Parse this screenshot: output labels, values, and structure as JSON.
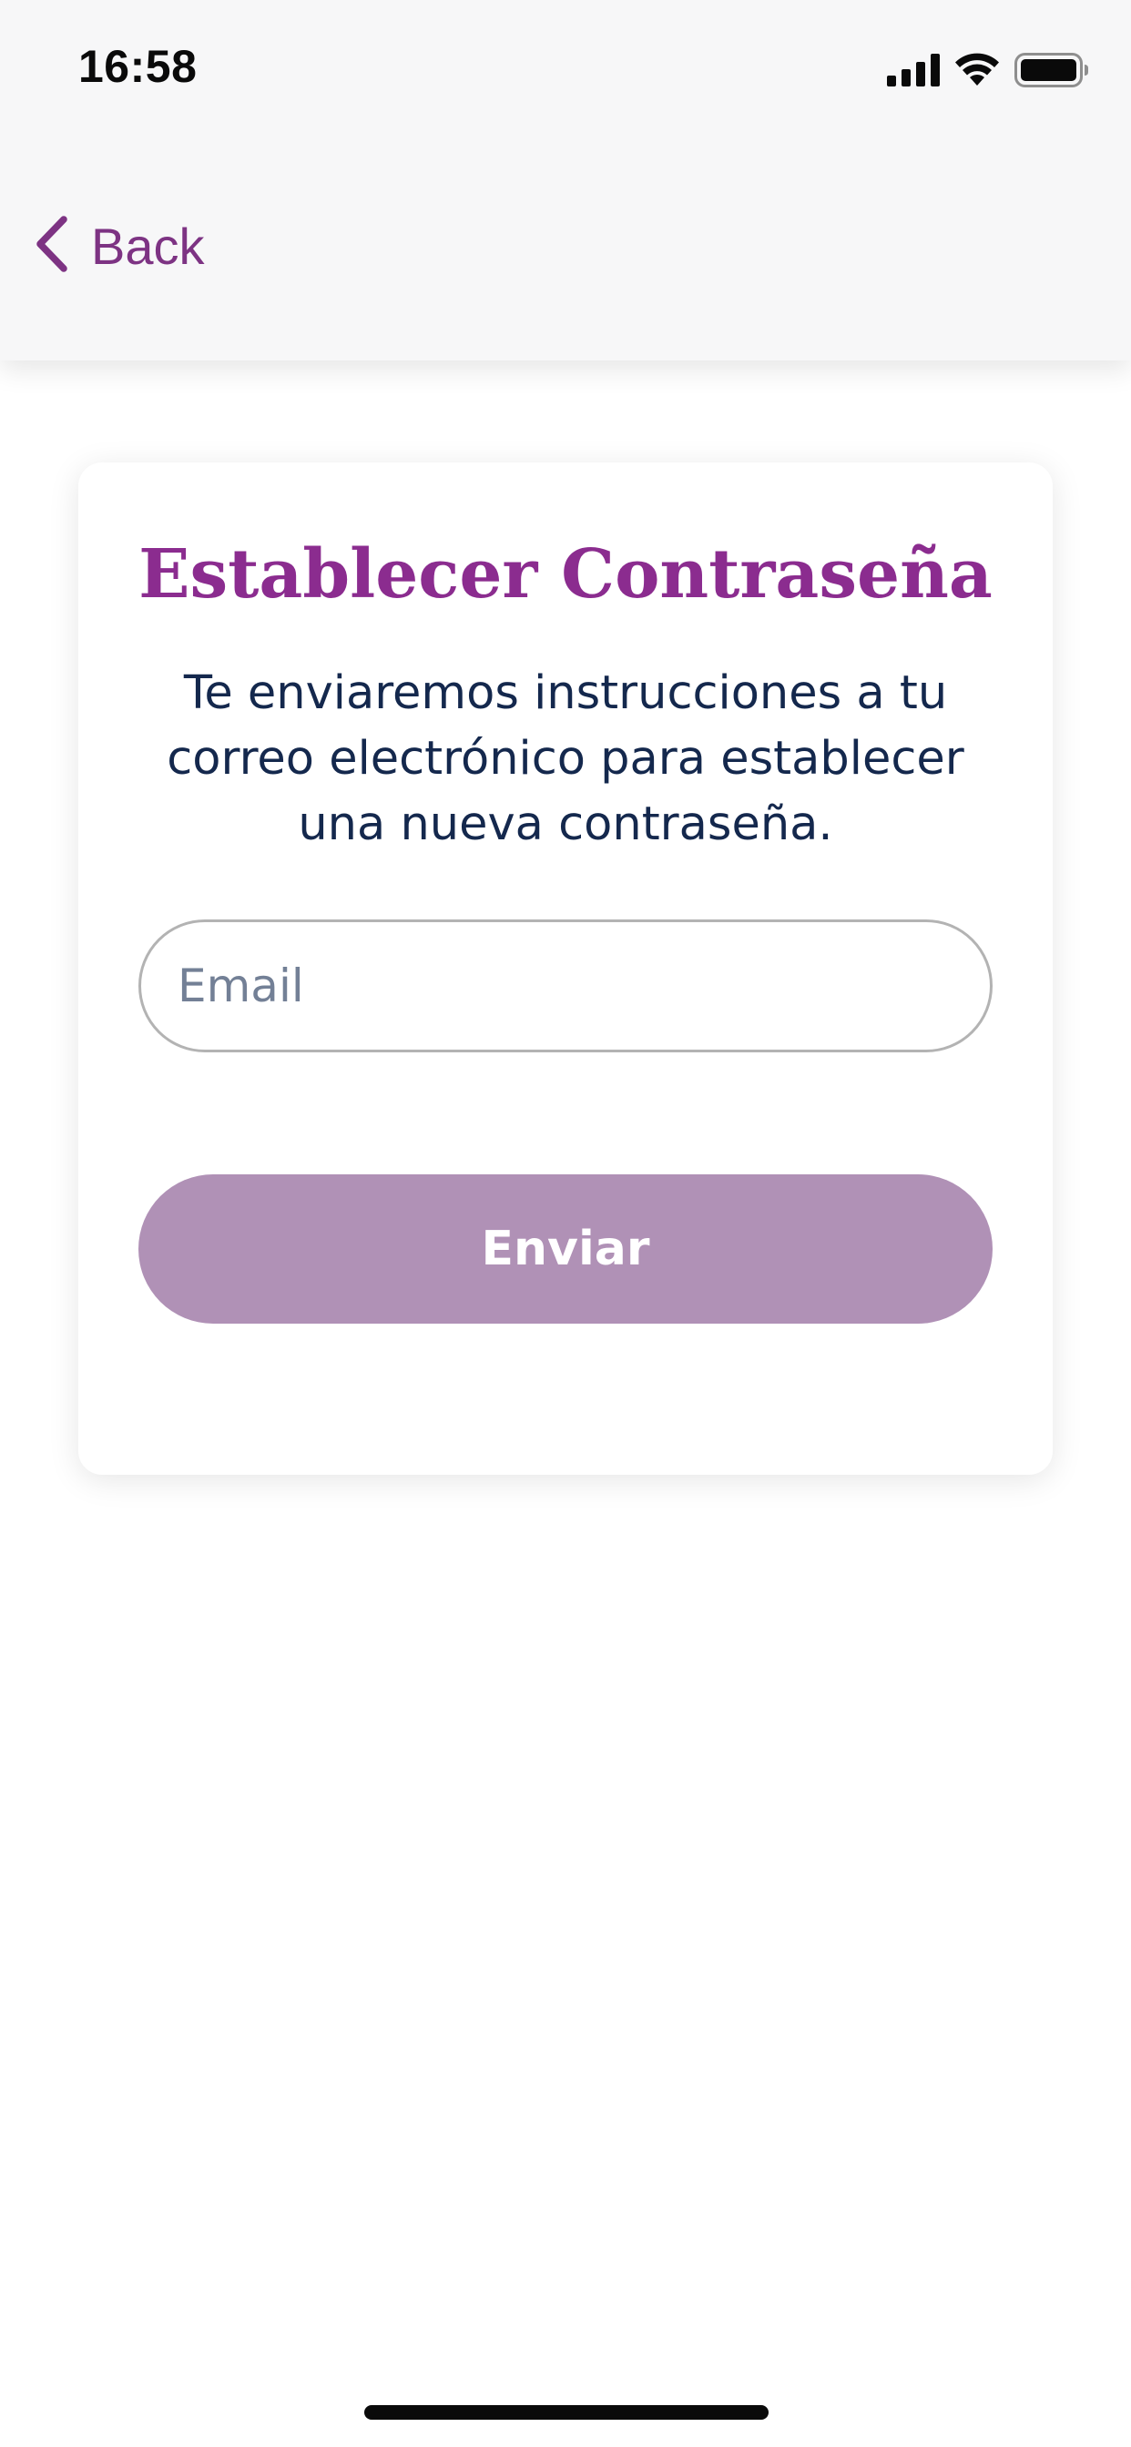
{
  "status_bar": {
    "time": "16:58",
    "icons": [
      "cellular-signal-icon",
      "wifi-icon",
      "battery-icon"
    ]
  },
  "nav": {
    "back_label": "Back",
    "back_icon": "chevron-left-icon"
  },
  "card": {
    "title": "Establecer Contraseña",
    "description": "Te enviaremos instrucciones a tu correo electrónico para establecer una nueva contraseña.",
    "email": {
      "value": "",
      "placeholder": "Email"
    },
    "submit_label": "Enviar"
  },
  "colors": {
    "accent": "#8b2c8f",
    "nav_tint": "#7d3383",
    "button_disabled": "#b091b6",
    "text_primary": "#14284d",
    "placeholder": "#738096",
    "header_bg": "#f7f7f8"
  }
}
